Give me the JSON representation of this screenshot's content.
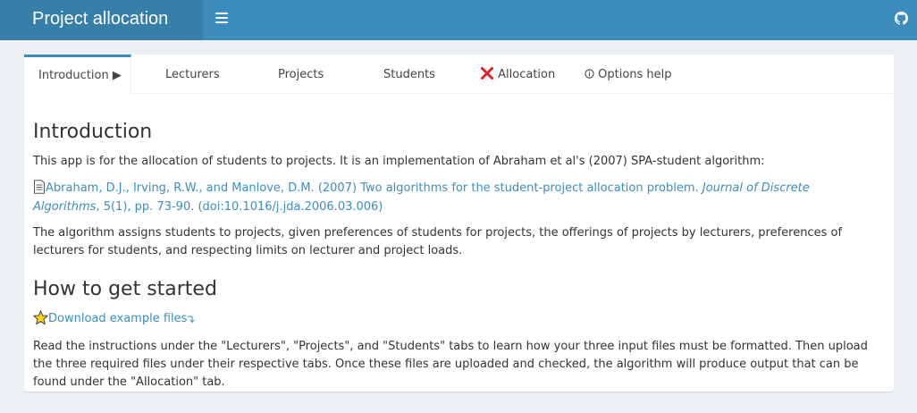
{
  "app": {
    "title": "Project allocation",
    "accent_color": "#3c8dbc",
    "header_icons": [
      "menu-icon",
      "github-icon"
    ]
  },
  "tabs": [
    {
      "label": "Introduction ▶",
      "active": true
    },
    {
      "label": "Lecturers",
      "active": false
    },
    {
      "label": "Projects",
      "active": false
    },
    {
      "label": "Students",
      "active": false
    },
    {
      "label": "Allocation",
      "active": false,
      "icon": "error-x-icon",
      "icon_color": "#dd2222"
    },
    {
      "label": "Options help",
      "active": false,
      "icon": "info-circle-icon"
    }
  ],
  "intro": {
    "heading": "Introduction",
    "text": "This app is for the allocation of students to projects. It is an implementation of Abraham et al's (2007) SPA-student algorithm:",
    "citation": {
      "icon": "document-icon",
      "main": "Abraham, D.J., Irving, R.W., and Manlove, D.M. (2007) Two algorithms for the student-project allocation problem.",
      "journal": "Journal of Discrete Algorithms",
      "details": ", 5(1), pp. 73-90.",
      "doi": "(doi:10.1016/j.jda.2006.03.006)"
    },
    "description": "The algorithm assigns students to projects, given preferences of students for projects, the offerings of projects by lecturers, preferences of lecturers for students, and respecting limits on lecturer and project loads."
  },
  "getting_started": {
    "heading": "How to get started",
    "download_icon": "star-icon",
    "download_label": "Download example files",
    "instructions": "Read the instructions under the \"Lecturers\", \"Projects\", and \"Students\" tabs to learn how your three input files must be formatted. Then upload the three required files under their respective tabs. Once these files are uploaded and checked, the algorithm will produce output that can be found under the \"Allocation\" tab."
  }
}
